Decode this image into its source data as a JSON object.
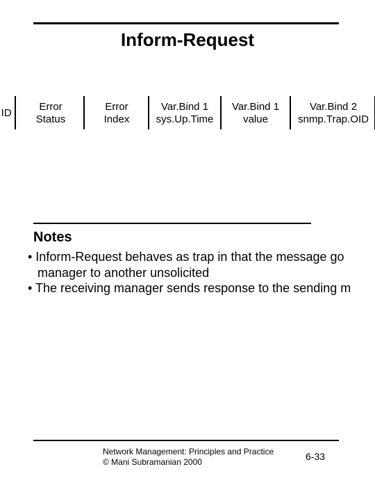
{
  "title": "Inform-Request",
  "pdu_fields": {
    "col0_l1": "t.ID",
    "col1_l1": "Error",
    "col1_l2": "Status",
    "col2_l1": "Error",
    "col2_l2": "Index",
    "col3_l1": "Var.Bind 1",
    "col3_l2": "sys.Up.Time",
    "col4_l1": "Var.Bind 1",
    "col4_l2": "value",
    "col5_l1": "Var.Bind 2",
    "col5_l2": "snmp.Trap.OID"
  },
  "notes_heading": "Notes",
  "notes": {
    "b1_line1": "• Inform-Request  behaves as trap in that the message go",
    "b1_line2": "manager to another unsolicited",
    "b2_line1": "• The receiving manager sends response to the sending m"
  },
  "footer": {
    "line1": "Network Management: Principles and Practice",
    "line2": "©  Mani Subramanian 2000",
    "page": "6-33"
  }
}
